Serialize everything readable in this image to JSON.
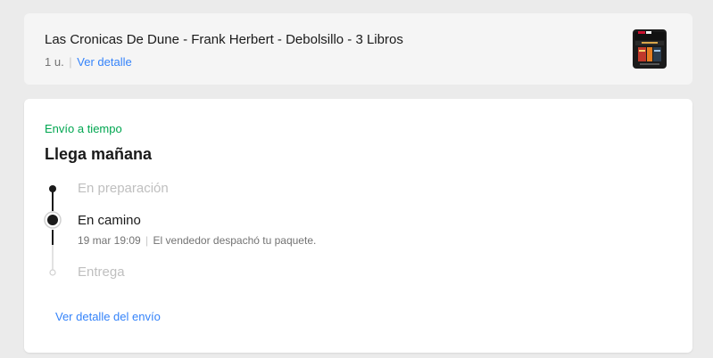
{
  "product": {
    "title": "Las Cronicas De Dune - Frank Herbert - Debolsillo - 3 Libros",
    "quantity": "1 u.",
    "detail_link": "Ver detalle",
    "thumbnail_icon": "book-set-thumbnail"
  },
  "shipping": {
    "status_tag": "Envío a tiempo",
    "headline": "Llega mañana",
    "steps": [
      {
        "label": "En preparación",
        "state": "done"
      },
      {
        "label": "En camino",
        "state": "current",
        "date": "19 mar 19:09",
        "description": "El vendedor despachó tu paquete."
      },
      {
        "label": "Entrega",
        "state": "pending"
      }
    ],
    "detail_link": "Ver detalle del envío"
  },
  "colors": {
    "accent_link": "#3483fa",
    "success": "#00a650",
    "background": "#ebebeb"
  }
}
